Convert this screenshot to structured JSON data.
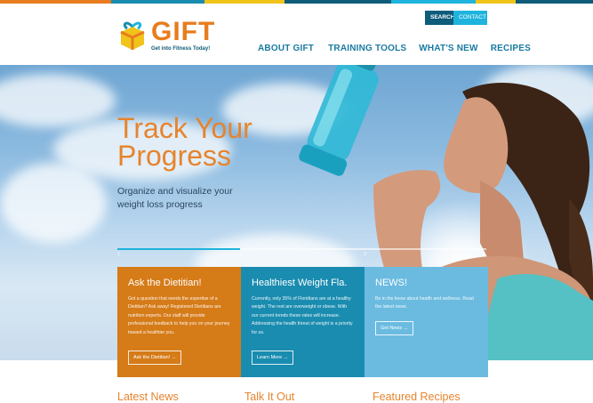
{
  "colors": {
    "orange": "#e6842e",
    "navy": "#0e5b7a",
    "cyan": "#1fb4dd",
    "teal": "#1a8cb0",
    "light_blue": "#6bbbe0",
    "panel_orange": "#d57b18"
  },
  "topbar_segments": [
    "#e87c1e",
    "#1a8cb0",
    "#f0c419",
    "#0e5b7a",
    "#1fb4dd",
    "#f0c419",
    "#0e5b7a"
  ],
  "utility": {
    "search_label": "SEARCH",
    "contact_label": "CONTACT"
  },
  "logo": {
    "title": "GIFT",
    "tagline": "Get into Fitness Today!",
    "icon": "gift-logo-icon"
  },
  "nav": {
    "items": [
      {
        "label": "ABOUT GIFT"
      },
      {
        "label": "TRAINING TOOLS"
      },
      {
        "label": "WHAT'S NEW"
      },
      {
        "label": "RECIPES"
      }
    ]
  },
  "hero": {
    "title": "Track Your Progress",
    "subtitle": "Organize and visualize your weight loss progress",
    "slider": {
      "numbers": [
        "1",
        "2",
        "3"
      ],
      "active_index": 1
    }
  },
  "panels": [
    {
      "title": "Ask the Dietitian!",
      "body": "Got a question that needs the expertise of a Dietitian? Ask away! Registered Dietitians are nutrition experts. Our staff will provide professional feedback to help you on your journey toward a healthier you.",
      "button": "Ask the Dietitian! →"
    },
    {
      "title": "Healthiest Weight Fla.",
      "body": "Currently, only 35% of Floridians are at a healthy weight. The rest are overweight or obese. With our current trends these rates will increase. Addressing the health threat of weight is a priority for us.",
      "button": "Learn More →"
    },
    {
      "title": "NEWS!",
      "body": "Be in the know about health and wellness. Read the latest news.",
      "button": "Get News →"
    }
  ],
  "sections": {
    "latest_news": "Latest News",
    "talk_it_out": "Talk It Out",
    "featured_recipes": "Featured Recipes"
  }
}
